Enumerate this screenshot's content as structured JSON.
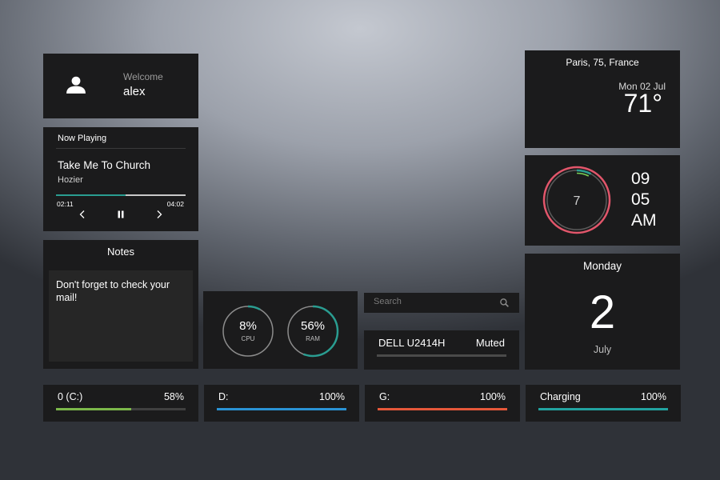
{
  "user": {
    "welcome": "Welcome",
    "name": "alex"
  },
  "now_playing": {
    "header": "Now Playing",
    "title": "Take Me To Church",
    "artist": "Hozier",
    "elapsed": "02:11",
    "duration": "04:02",
    "progress": 0.54,
    "accent": "#2a9d91"
  },
  "notes": {
    "header": "Notes",
    "text": "Don't forget to check your mail!"
  },
  "system": {
    "cpu": {
      "value": "8%",
      "label": "CPU",
      "fraction": 0.08
    },
    "ram": {
      "value": "56%",
      "label": "RAM",
      "fraction": 0.56
    },
    "accent": "#2a9d91"
  },
  "search": {
    "placeholder": "Search",
    "icon": "search-icon"
  },
  "monitor": {
    "name": "DELL U2414H",
    "state": "Muted"
  },
  "weather": {
    "location": "Paris, 75, France",
    "date": "Mon 02 Jul",
    "temperature": "71°"
  },
  "clock": {
    "dial_number": "7",
    "hour": "09",
    "minute": "05",
    "ampm": "AM",
    "hour_color": "#e2566b",
    "minute_color": "#2a9d91",
    "second_color": "#7ad155"
  },
  "calendar": {
    "weekday": "Monday",
    "day": "2",
    "month": "July"
  },
  "drives": [
    {
      "label": "0 (C:)",
      "percent": "58%",
      "fraction": 0.58,
      "color": "#7cb84a"
    },
    {
      "label": "D:",
      "percent": "100%",
      "fraction": 1.0,
      "color": "#2a93d5"
    },
    {
      "label": "G:",
      "percent": "100%",
      "fraction": 1.0,
      "color": "#e5583a"
    }
  ],
  "battery": {
    "label": "Charging",
    "percent": "100%",
    "fraction": 1.0,
    "color": "#22a3a0"
  }
}
